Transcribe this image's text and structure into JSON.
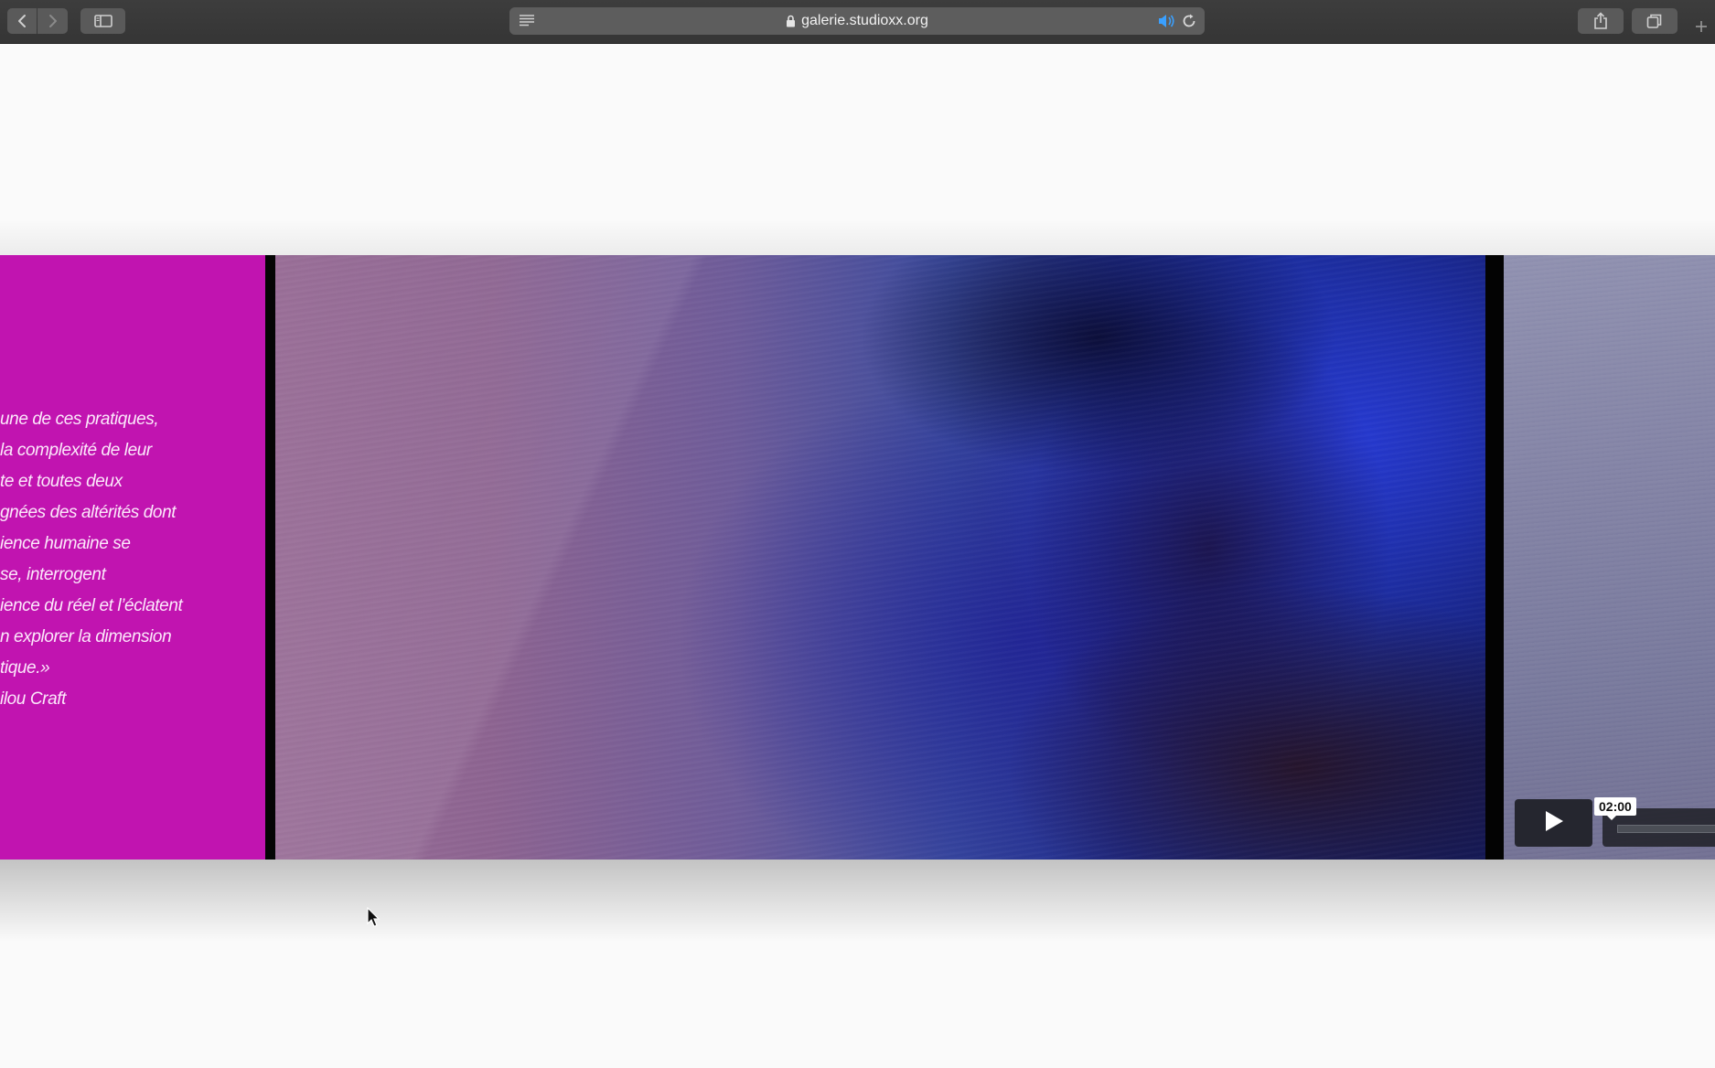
{
  "browser": {
    "url": "galerie.studioxx.org",
    "icons": {
      "back": "chevron-left-icon",
      "forward": "chevron-right-icon",
      "sidebar": "sidebar-icon",
      "reader": "reader-icon",
      "lock": "lock-icon",
      "sound": "speaker-icon",
      "reload": "reload-icon",
      "share": "share-icon",
      "tabs": "tabs-overview-icon",
      "new_tab": "plus-icon"
    },
    "colors": {
      "toolbar": "#3a3a3a",
      "address_bar": "#5d5d5d",
      "audio_indicator": "#3aa0ff"
    }
  },
  "gallery": {
    "panel_color": "#c114b0",
    "quote_lines": [
      "une de ces pratiques,",
      " la complexité de leur",
      "te et toutes deux",
      "gnées des altérités dont",
      "ience humaine se",
      "se, interrogent",
      "ience du réel et l’éclatent",
      "n explorer la dimension",
      "tique.»",
      "ilou Craft"
    ],
    "video": {
      "play_icon": "play-icon",
      "time": "02:00"
    }
  }
}
